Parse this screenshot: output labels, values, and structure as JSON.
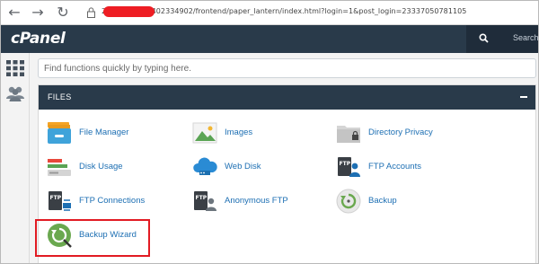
{
  "browser": {
    "back_icon": "arrow-left-icon",
    "forward_icon": "arrow-right-icon",
    "reload_icon": "reload-icon",
    "url": "2083/cpsess1402334902/frontend/paper_lantern/index.html?login=1&post_login=23337050781105"
  },
  "header": {
    "logo": "cPanel",
    "search_label": "Search"
  },
  "search": {
    "placeholder": "Find functions quickly by typing here."
  },
  "files": {
    "title": "FILES",
    "items": [
      {
        "label": "File Manager",
        "icon": "file-manager-icon"
      },
      {
        "label": "Images",
        "icon": "images-icon"
      },
      {
        "label": "Directory Privacy",
        "icon": "directory-privacy-icon"
      },
      {
        "label": "Disk Usage",
        "icon": "disk-usage-icon"
      },
      {
        "label": "Web Disk",
        "icon": "web-disk-icon"
      },
      {
        "label": "FTP Accounts",
        "icon": "ftp-accounts-icon"
      },
      {
        "label": "FTP Connections",
        "icon": "ftp-connections-icon"
      },
      {
        "label": "Anonymous FTP",
        "icon": "anonymous-ftp-icon"
      },
      {
        "label": "Backup",
        "icon": "backup-icon"
      },
      {
        "label": "Backup Wizard",
        "icon": "backup-wizard-icon"
      }
    ]
  },
  "colors": {
    "header_bg": "#293a4a",
    "link": "#1d6fb3",
    "highlight": "#e21b23"
  }
}
